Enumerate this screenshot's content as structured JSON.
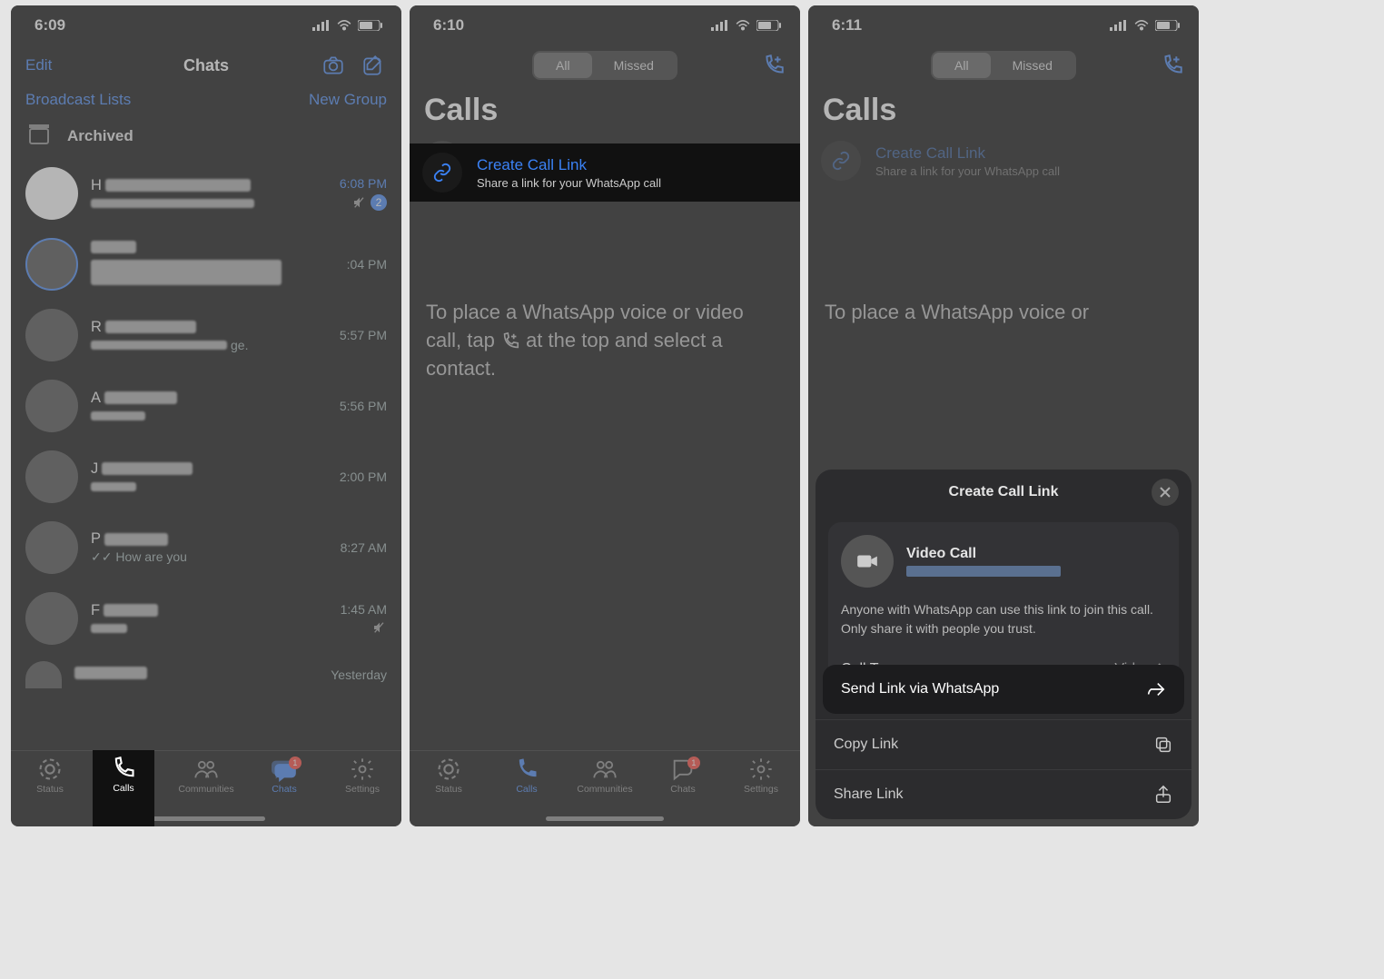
{
  "phone1": {
    "time": "6:09",
    "edit": "Edit",
    "title": "Chats",
    "broadcast": "Broadcast Lists",
    "newgroup": "New Group",
    "archived": "Archived",
    "chats": [
      {
        "name": "H",
        "sub": "",
        "time": "6:08 PM",
        "badge": "2",
        "muted": true
      },
      {
        "name": "",
        "sub": "",
        "time": ":04 PM"
      },
      {
        "name": "R",
        "sub": "ge.",
        "time": "5:57 PM"
      },
      {
        "name": "A",
        "sub": "",
        "time": "5:56 PM"
      },
      {
        "name": "J",
        "sub": "",
        "time": "2:00 PM"
      },
      {
        "name": "P",
        "sub": "✓✓ How are you",
        "time": "8:27 AM"
      },
      {
        "name": "F",
        "sub": "",
        "time": "1:45 AM",
        "muted": true
      },
      {
        "name": "",
        "sub": "",
        "time": "Yesterday"
      }
    ],
    "tabs": {
      "status": "Status",
      "calls": "Calls",
      "communities": "Communities",
      "chats": "Chats",
      "settings": "Settings",
      "chat_badge": "1"
    }
  },
  "phone2": {
    "time": "6:10",
    "seg_all": "All",
    "seg_missed": "Missed",
    "title": "Calls",
    "create_ttl": "Create Call Link",
    "create_sub": "Share a link for your WhatsApp call",
    "help1": "To place a WhatsApp voice or video call, tap ",
    "help2": " at the top and select a contact.",
    "tabs": {
      "status": "Status",
      "calls": "Calls",
      "communities": "Communities",
      "chats": "Chats",
      "settings": "Settings",
      "chat_badge": "1"
    }
  },
  "phone3": {
    "time": "6:11",
    "seg_all": "All",
    "seg_missed": "Missed",
    "title": "Calls",
    "create_ttl": "Create Call Link",
    "create_sub": "Share a link for your WhatsApp call",
    "help1": "To place a WhatsApp voice or",
    "sheet": {
      "title": "Create Call Link",
      "vidtype": "Video Call",
      "note": "Anyone with WhatsApp can use this link to join this call. Only share it with people you trust.",
      "calltype_label": "Call Type",
      "calltype_value": "Video",
      "send": "Send Link via WhatsApp",
      "copy": "Copy Link",
      "share": "Share Link"
    }
  }
}
